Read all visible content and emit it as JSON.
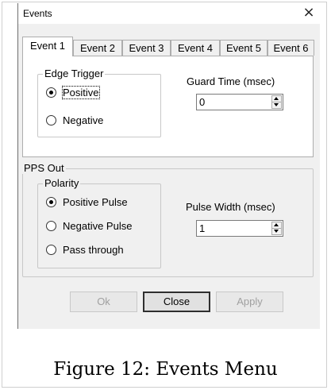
{
  "window": {
    "title": "Events",
    "close_glyph": "×"
  },
  "tabs": [
    {
      "label": "Event 1",
      "active": true
    },
    {
      "label": "Event 2",
      "active": false
    },
    {
      "label": "Event 3",
      "active": false
    },
    {
      "label": "Event 4",
      "active": false
    },
    {
      "label": "Event 5",
      "active": false
    },
    {
      "label": "Event 6",
      "active": false
    }
  ],
  "edge_trigger": {
    "title": "Edge Trigger",
    "options": [
      {
        "label": "Positive",
        "checked": true
      },
      {
        "label": "Negative",
        "checked": false
      }
    ]
  },
  "guard_time": {
    "label": "Guard Time (msec)",
    "value": "0"
  },
  "pps_out": {
    "title": "PPS Out",
    "polarity": {
      "title": "Polarity",
      "options": [
        {
          "label": "Positive Pulse",
          "checked": true
        },
        {
          "label": "Negative Pulse",
          "checked": false
        },
        {
          "label": "Pass through",
          "checked": false
        }
      ]
    },
    "pulse_width": {
      "label": "Pulse Width (msec)",
      "value": "1"
    }
  },
  "buttons": {
    "ok": "Ok",
    "close": "Close",
    "apply": "Apply"
  },
  "caption": "Figure 12: Events Menu"
}
